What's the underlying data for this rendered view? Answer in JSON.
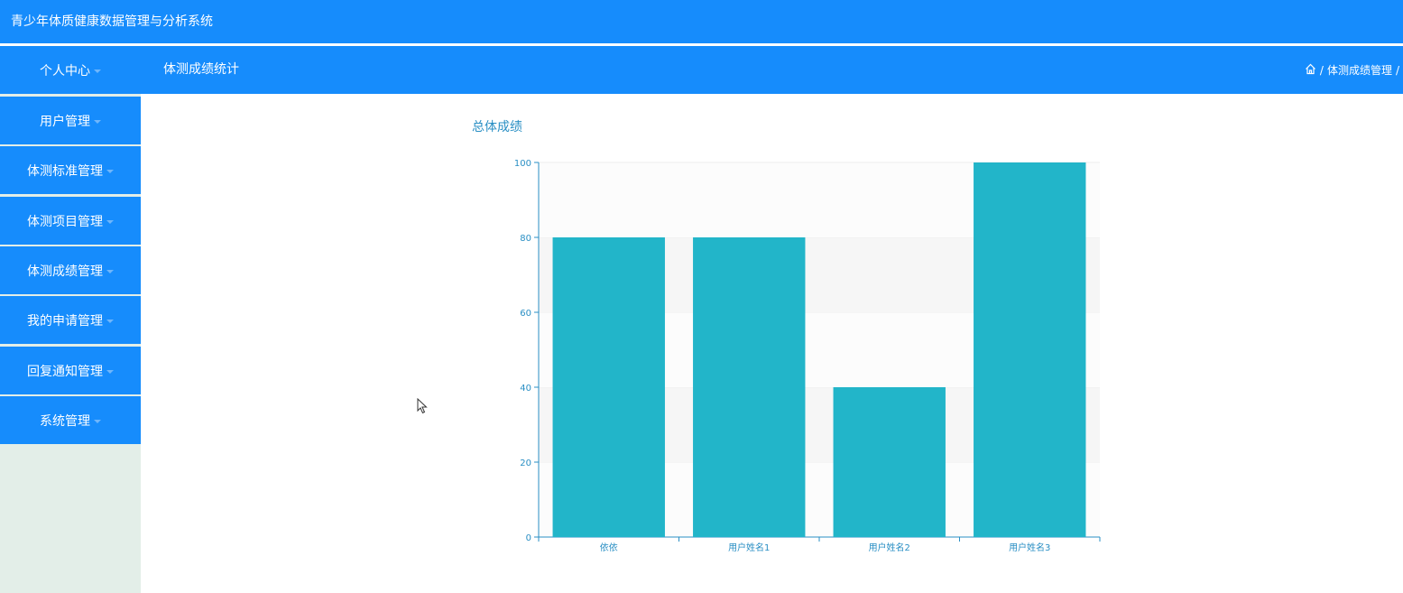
{
  "app": {
    "title": "青少年体质健康数据管理与分析系统"
  },
  "header": {
    "menu_head": "个人中心",
    "page_heading": "体测成绩统计",
    "breadcrumb": {
      "current": "体测成绩管理",
      "sep": "/"
    }
  },
  "sidebar": {
    "items": [
      {
        "label": "用户管理"
      },
      {
        "label": "体测标准管理"
      },
      {
        "label": "体测项目管理"
      },
      {
        "label": "体测成绩管理"
      },
      {
        "label": "我的申请管理"
      },
      {
        "label": "回复通知管理"
      },
      {
        "label": "系统管理"
      }
    ]
  },
  "colors": {
    "primary": "#168cfc",
    "bar": "#22b5c9",
    "axis": "#2a8fc4",
    "sidebar_bg": "#e3eee8"
  },
  "chart_data": {
    "type": "bar",
    "title": "总体成绩",
    "categories": [
      "依依",
      "用户姓名1",
      "用户姓名2",
      "用户姓名3"
    ],
    "values": [
      80,
      80,
      40,
      100
    ],
    "ylim": [
      0,
      100
    ],
    "yticks": [
      0,
      20,
      40,
      60,
      80,
      100
    ],
    "xlabel": "",
    "ylabel": "",
    "grid": "horizontal-bands"
  }
}
